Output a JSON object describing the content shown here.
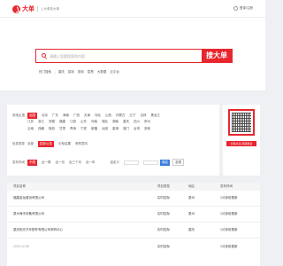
{
  "header": {
    "logo_name": "大单",
    "slogan": "上大单查大单",
    "login_label": "登录/注册"
  },
  "search": {
    "placeholder": "请输入您要搜索的内容",
    "button_label": "搜大单"
  },
  "hot_links": [
    "热门搜索",
    "重庆",
    "招标",
    "投标",
    "智慧",
    "大数据",
    "云平台"
  ],
  "filters": {
    "region": {
      "label": "按地区搜",
      "options": [
        "全国",
        "北京",
        "广东",
        "海南",
        "广西",
        "天津",
        "河北",
        "山西",
        "内蒙古",
        "辽宁",
        "吉林",
        "黑龙江"
      ],
      "options_row2": [
        "江苏",
        "浙江",
        "安徽",
        "福建",
        "江西",
        "山东",
        "河南",
        "湖北",
        "湖南",
        "重庆",
        "四川",
        "贵州"
      ],
      "options_row3": [
        "云南",
        "西藏",
        "陕西",
        "甘肃",
        "青海",
        "宁夏",
        "新疆",
        "兵团",
        "香港",
        "澳门",
        "台湾",
        "其他"
      ]
    },
    "type": {
      "label": "信息类型",
      "options": [
        "全部",
        "招标公告",
        "中标结果",
        "采购意向"
      ]
    },
    "time": {
      "label": "发布时间",
      "options": [
        "不限",
        "近一周",
        "近一月",
        "近三个月",
        "近一年"
      ],
      "custom_label": "自定义",
      "apply_label": "确定",
      "reset_label": "重置"
    }
  },
  "qr": {
    "caption": "扫码关注 获取更多"
  },
  "table": {
    "headers": [
      "项目名称",
      "项目类型",
      "地区",
      "发布时间"
    ],
    "rows": [
      {
        "name": "福建金龙建设有限公司",
        "type": "实时招标",
        "region": "泉州",
        "time": "1分钟前更新"
      },
      {
        "name": "泉州海丰设备有限公司",
        "type": "实时招标",
        "region": "泉州",
        "time": "1分钟前更新"
      },
      {
        "name": "重庆阳光汽车配件有限公司采购中心",
        "type": "实时招标",
        "region": "重庆",
        "time": "1分钟前更新"
      }
    ],
    "date_line": "2024-12-06",
    "last_row_type": "实时招标",
    "last_row_time": "1分钟前更新"
  },
  "colors": {
    "brand_red": "#e8262e",
    "accent_blue": "#3b7ddd"
  }
}
